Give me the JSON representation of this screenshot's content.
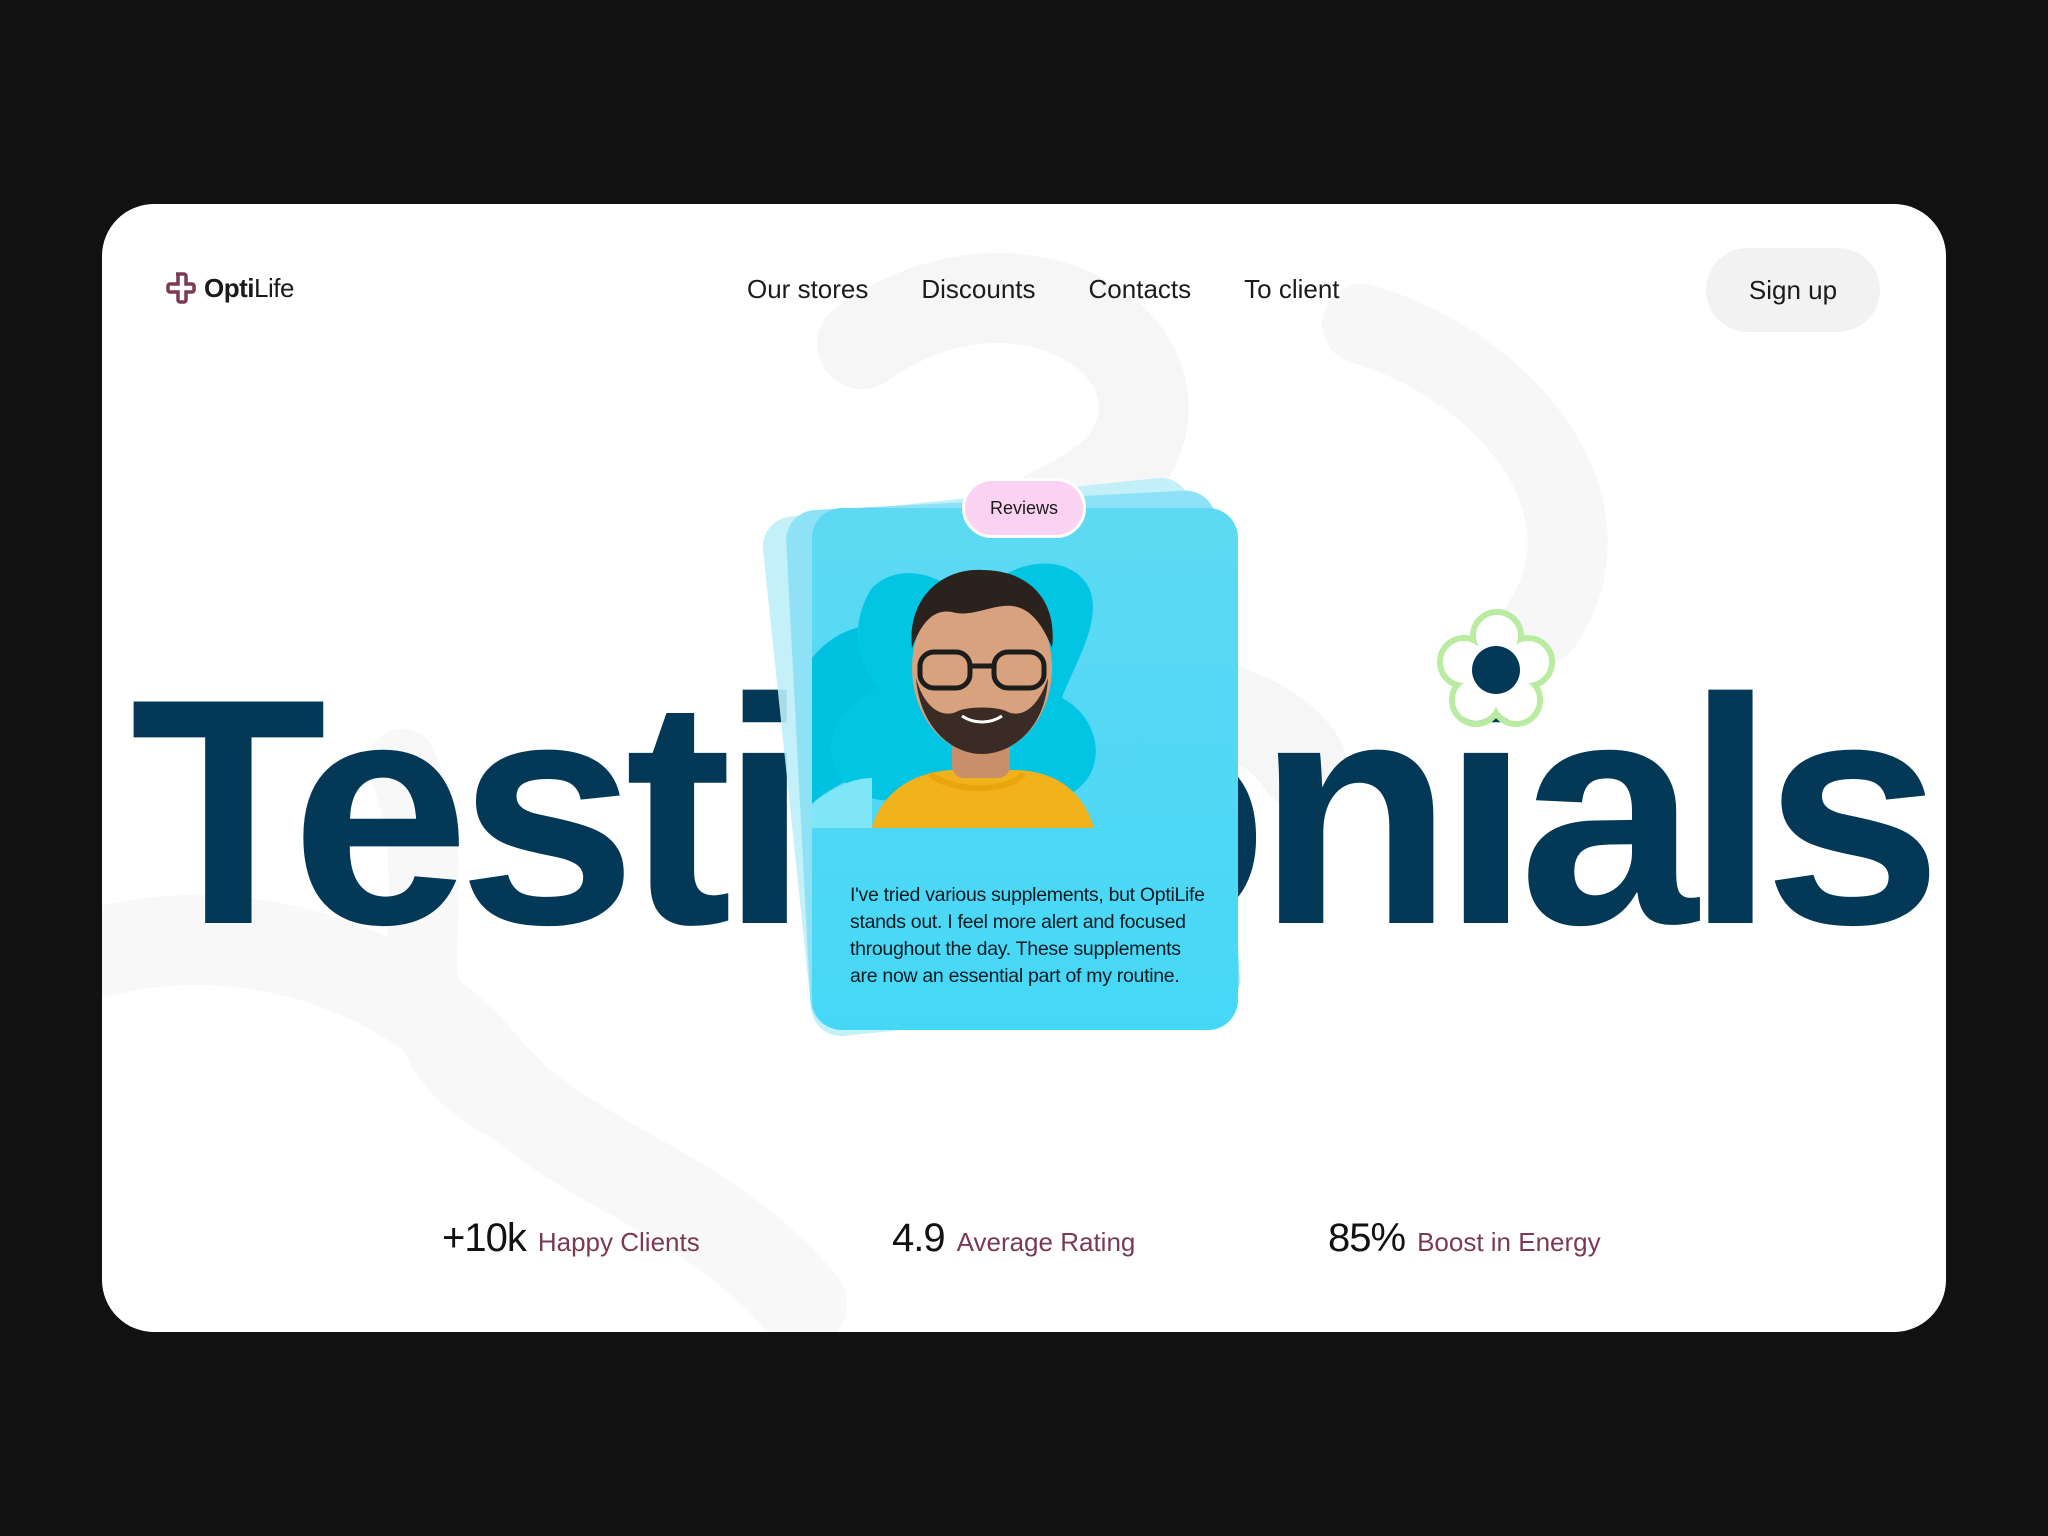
{
  "brand": {
    "name_bold": "Opti",
    "name_regular": "Life",
    "accent": "#7a3a55"
  },
  "nav": {
    "items": [
      {
        "label": "Our stores"
      },
      {
        "label": "Discounts"
      },
      {
        "label": "Contacts"
      },
      {
        "label": "To client"
      }
    ],
    "signup_label": "Sign up"
  },
  "hero": {
    "headline": "Testimonials",
    "headline_color": "#033957"
  },
  "card": {
    "badge": "Reviews",
    "quote": "I've tried various supplements, but OptiLife stands out. I feel more alert and focused throughout the day. These supplements are now an essential part of my routine.",
    "color": "#45d8f6"
  },
  "stats": [
    {
      "value": "+10k",
      "label": "Happy Clients"
    },
    {
      "value": "4.9",
      "label": "Average Rating"
    },
    {
      "value": "85%",
      "label": "Boost in Energy"
    }
  ]
}
